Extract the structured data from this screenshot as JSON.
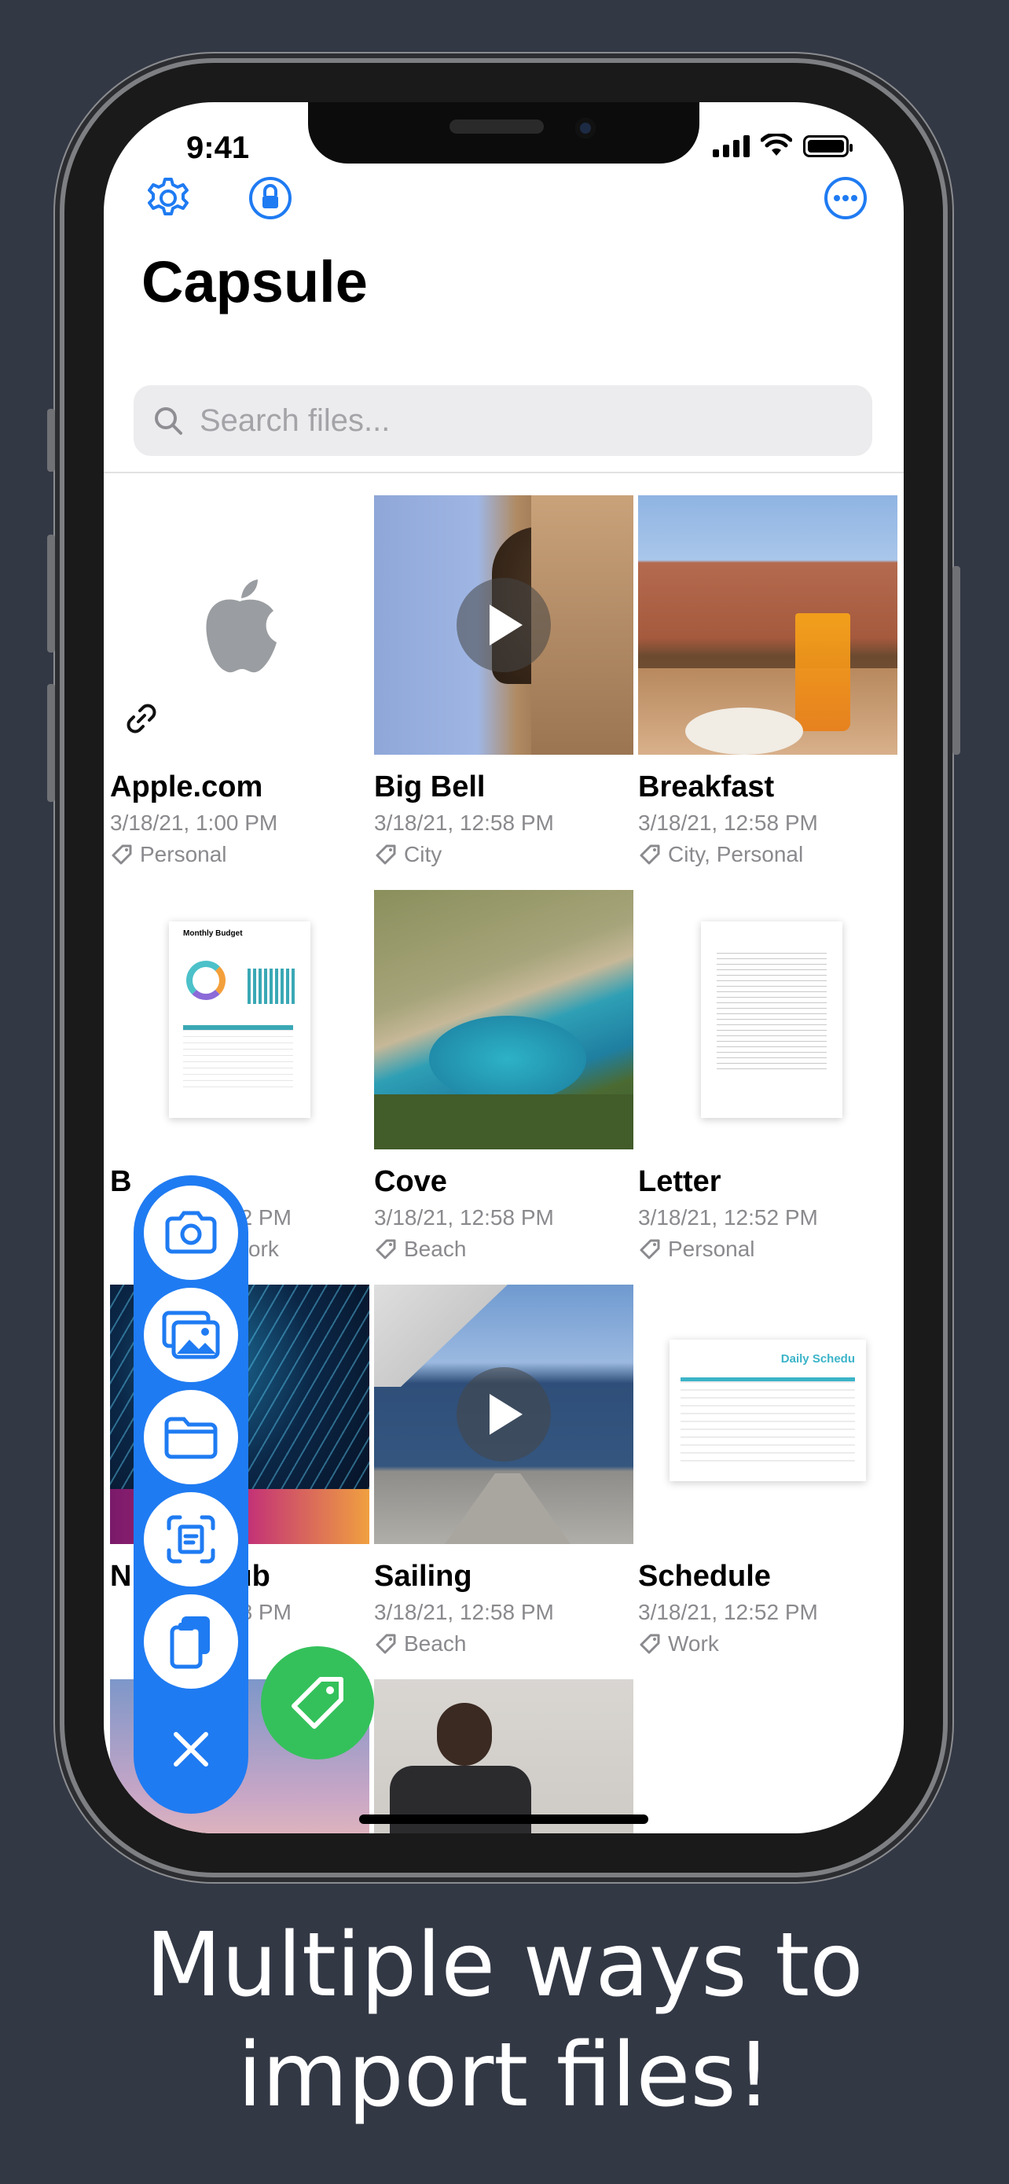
{
  "status": {
    "time": "9:41"
  },
  "header": {
    "title": "Capsule"
  },
  "search": {
    "placeholder": "Search files..."
  },
  "files": [
    {
      "title": "Apple.com",
      "date": "3/18/21, 1:00 PM",
      "tags": "Personal"
    },
    {
      "title": "Big Bell",
      "date": "3/18/21, 12:58 PM",
      "tags": "City"
    },
    {
      "title": "Breakfast",
      "date": "3/18/21, 12:58 PM",
      "tags": "City, Personal"
    },
    {
      "title": "B",
      "date": "52 PM",
      "tags": "Work"
    },
    {
      "title": "Cove",
      "date": "3/18/21, 12:58 PM",
      "tags": "Beach"
    },
    {
      "title": "Letter",
      "date": "3/18/21, 12:52 PM",
      "tags": "Personal"
    },
    {
      "title": "N",
      "title2": "ub",
      "date": "58 PM",
      "tags": ""
    },
    {
      "title": "Sailing",
      "date": "3/18/21, 12:58 PM",
      "tags": "Beach"
    },
    {
      "title": "Schedule",
      "date": "3/18/21, 12:52 PM",
      "tags": "Work"
    }
  ],
  "docs": {
    "budget_title": "Monthly Budget",
    "schedule_title": "Daily Schedu"
  },
  "caption": {
    "line1": "Multiple ways to",
    "line2": "import files!"
  },
  "colors": {
    "accent": "#1f7bf2",
    "tag_button": "#34c15b",
    "background": "#333845"
  }
}
